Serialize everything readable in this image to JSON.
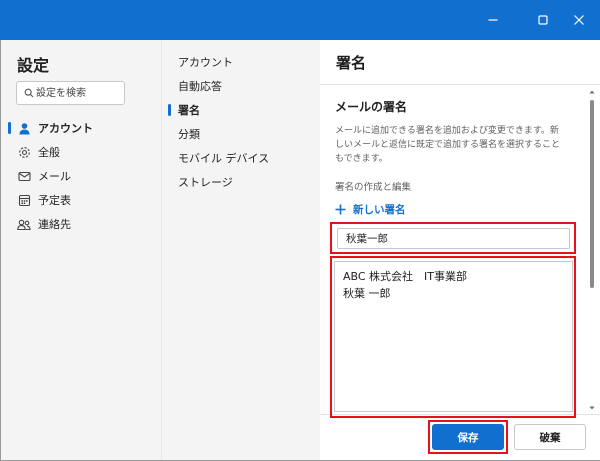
{
  "window": {
    "title_color": "#1170cf",
    "buttons": [
      "minimize-icon",
      "maximize-icon",
      "close-icon"
    ]
  },
  "settings": {
    "title": "設定",
    "search_placeholder": "設定を検索",
    "nav": [
      {
        "label": "アカウント",
        "icon": "person-icon",
        "active": true
      },
      {
        "label": "全般",
        "icon": "gear-icon"
      },
      {
        "label": "メール",
        "icon": "mail-icon"
      },
      {
        "label": "予定表",
        "icon": "calendar-icon"
      },
      {
        "label": "連絡先",
        "icon": "people-icon"
      }
    ]
  },
  "account_nav": {
    "items": [
      {
        "label": "アカウント"
      },
      {
        "label": "自動応答"
      },
      {
        "label": "署名",
        "active": true
      },
      {
        "label": "分類"
      },
      {
        "label": "モバイル デバイス"
      },
      {
        "label": "ストレージ"
      }
    ]
  },
  "signature": {
    "pane_title": "署名",
    "section_title": "メールの署名",
    "description": "メールに追加できる署名を追加および変更できます。新しいメールと返信に既定で追加する署名を選択することもできます。",
    "create_label": "署名の作成と編集",
    "new_signature": "新しい署名",
    "name_value": "秋葉一郎",
    "body_lines": [
      "ABC 株式会社　IT事業部",
      "秋葉 一郎"
    ],
    "save_label": "保存",
    "discard_label": "破棄",
    "highlight_color": "#e8101c"
  }
}
